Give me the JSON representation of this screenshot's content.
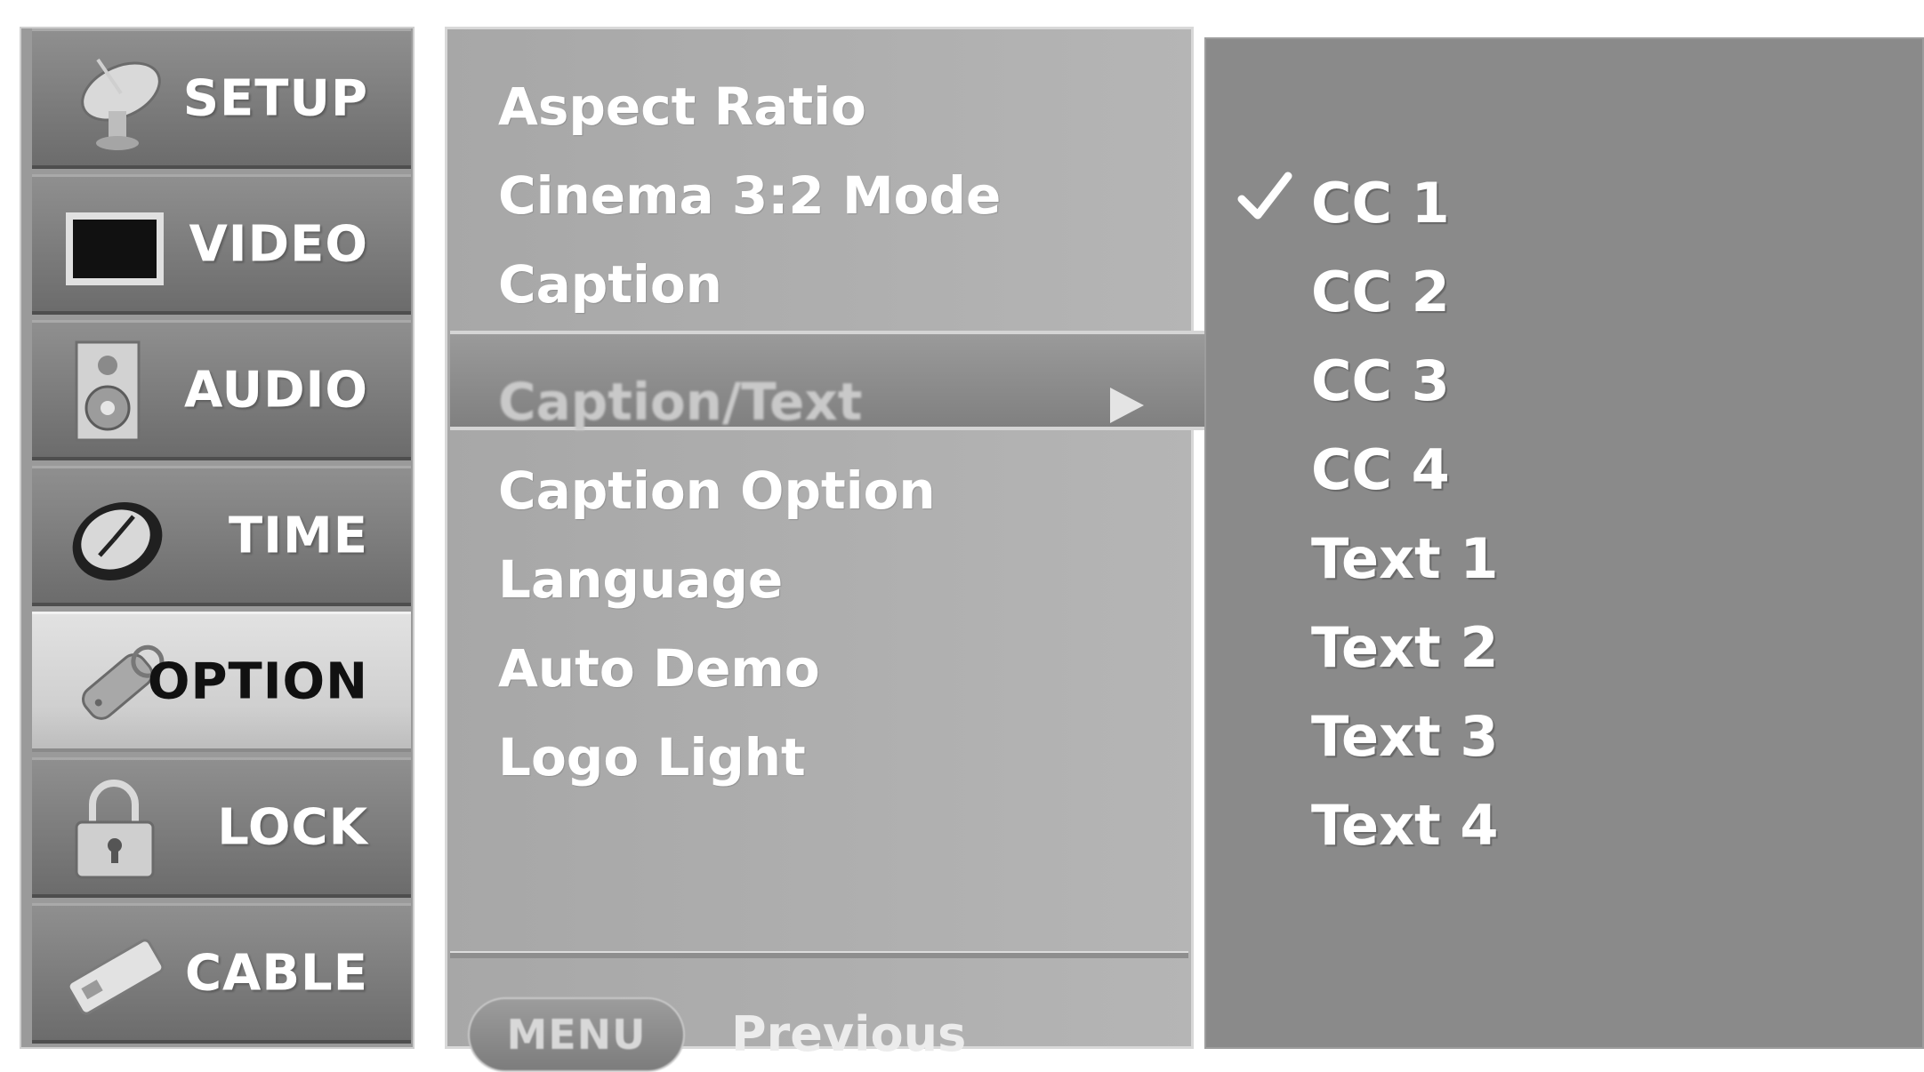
{
  "categories": [
    {
      "label": "SETUP",
      "icon": "satellite-dish-icon",
      "active": false
    },
    {
      "label": "VIDEO",
      "icon": "tv-screen-icon",
      "active": false
    },
    {
      "label": "AUDIO",
      "icon": "speaker-icon",
      "active": false
    },
    {
      "label": "TIME",
      "icon": "clock-icon",
      "active": false
    },
    {
      "label": "OPTION",
      "icon": "tag-icon",
      "active": true
    },
    {
      "label": "LOCK",
      "icon": "padlock-icon",
      "active": false
    },
    {
      "label": "CABLE",
      "icon": "cable-card-icon",
      "active": false
    }
  ],
  "options": {
    "items": [
      "Aspect Ratio",
      "Cinema 3:2 Mode",
      "Caption",
      "Caption/Text",
      "Caption Option",
      "Language",
      "Auto Demo",
      "Logo Light"
    ],
    "selected": "Caption/Text",
    "selected_icon": "play-arrow-icon"
  },
  "footer": {
    "menu_button": "MENU",
    "previous_label": "Previous"
  },
  "values": {
    "items": [
      "CC 1",
      "CC 2",
      "CC 3",
      "CC 4",
      "Text 1",
      "Text 2",
      "Text 3",
      "Text 4"
    ],
    "checked": "CC 1",
    "checked_icon": "checkmark-icon"
  }
}
